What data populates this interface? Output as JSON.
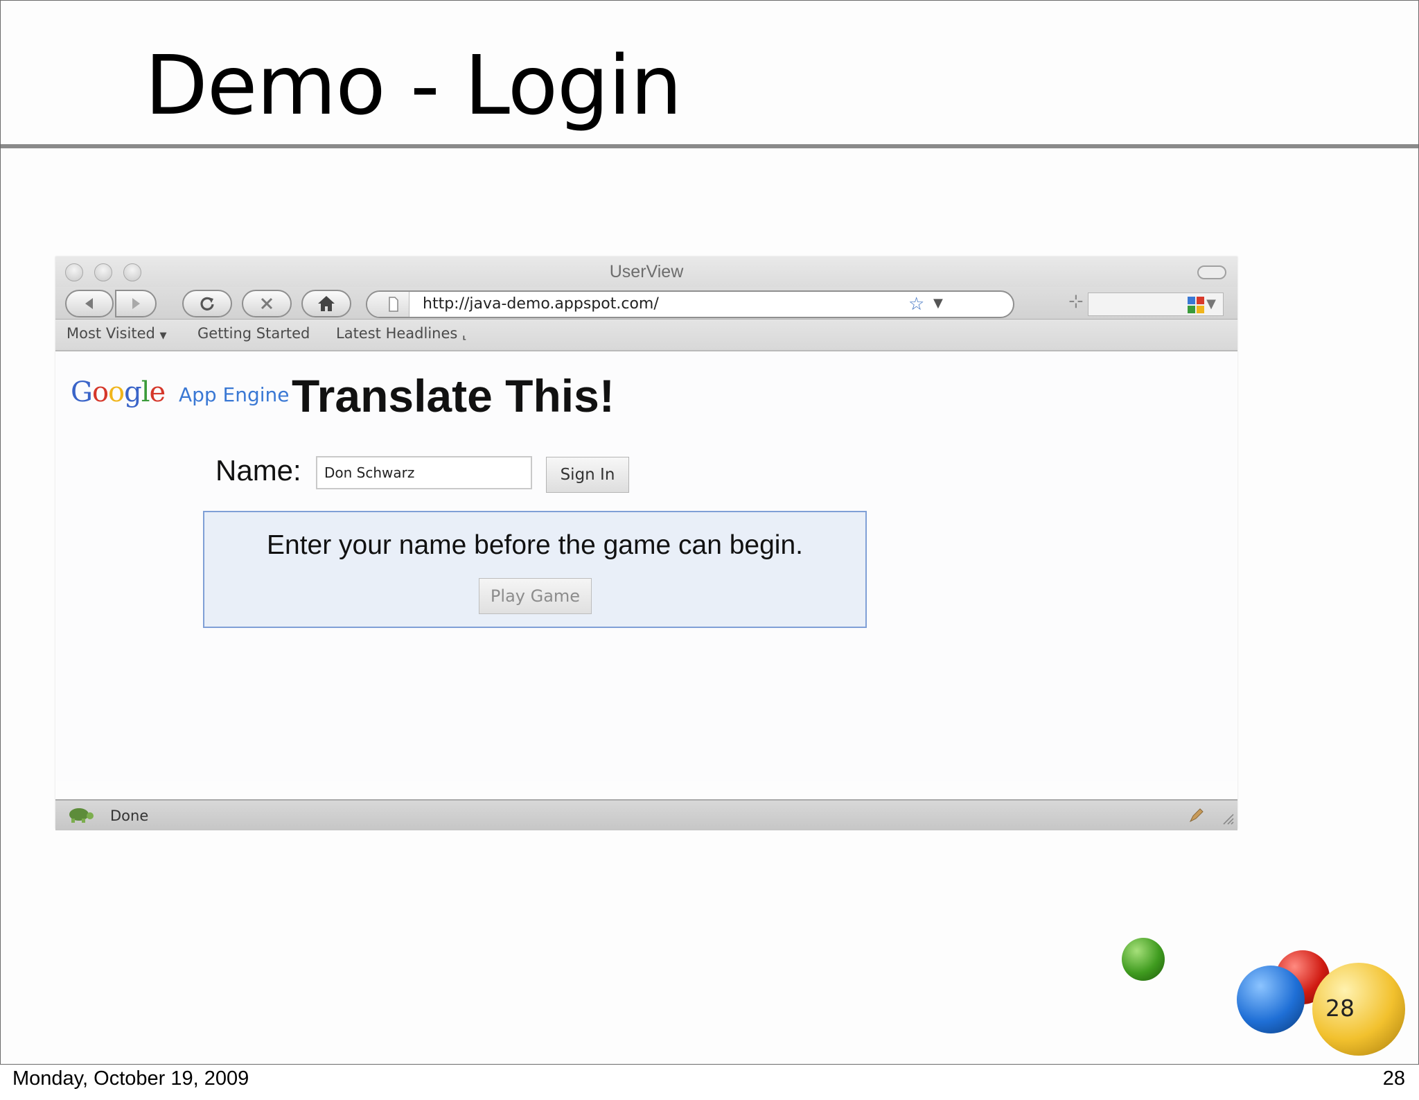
{
  "slide": {
    "title": "Demo - Login",
    "footer_date": "Monday, October 19, 2009",
    "page_number": "28",
    "badge_number": "28"
  },
  "browser": {
    "window_title": "UserView",
    "url": "http://java-demo.appspot.com/",
    "bookmarks": [
      "Most Visited",
      "Getting Started",
      "Latest Headlines"
    ],
    "status": "Done"
  },
  "app": {
    "logo_google": "Google",
    "logo_app_engine": "App Engine",
    "heading": "Translate This!",
    "name_label": "Name:",
    "name_value": "Don Schwarz",
    "signin_label": "Sign In",
    "notice_text": "Enter your name before the game can begin.",
    "play_label": "Play Game"
  },
  "icons": {
    "back": "back-arrow-icon",
    "forward": "forward-arrow-icon",
    "reload": "reload-icon",
    "stop": "stop-icon",
    "home": "home-icon",
    "bookmark_star": "star-icon",
    "rss": "rss-icon",
    "status_turtle": "turtle-icon"
  },
  "colors": {
    "accent_blue": "#3a78d4",
    "notice_bg": "#e9eff8",
    "notice_border": "#7f9fd6",
    "ball_green": "#3f9b1f",
    "ball_red": "#d01b12",
    "ball_blue": "#1f6fd6",
    "ball_yellow": "#f2c12e"
  }
}
